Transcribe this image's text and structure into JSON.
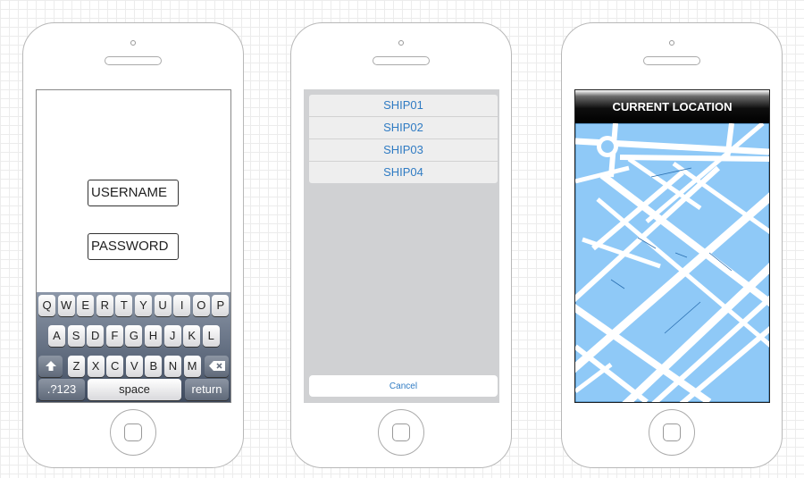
{
  "login_screen": {
    "username_field": "USERNAME",
    "password_field": "PASSWORD",
    "keyboard": {
      "row1": [
        "Q",
        "W",
        "E",
        "R",
        "T",
        "Y",
        "U",
        "I",
        "O",
        "P"
      ],
      "row2": [
        "A",
        "S",
        "D",
        "F",
        "G",
        "H",
        "J",
        "K",
        "L"
      ],
      "row3": [
        "Z",
        "X",
        "C",
        "V",
        "B",
        "N",
        "M"
      ],
      "shift_icon": "shift-arrow-icon",
      "delete_icon": "backspace-icon",
      "numbers_key": ".?123",
      "space_key": "space",
      "return_key": "return"
    }
  },
  "ship_picker": {
    "items": [
      "SHIP01",
      "SHIP02",
      "SHIP03",
      "SHIP04"
    ],
    "cancel_label": "Cancel",
    "link_color": "#2f7bc3"
  },
  "map_screen": {
    "header_title": "CURRENT LOCATION",
    "water_color": "#8fc9f7",
    "road_color": "#ffffff"
  }
}
